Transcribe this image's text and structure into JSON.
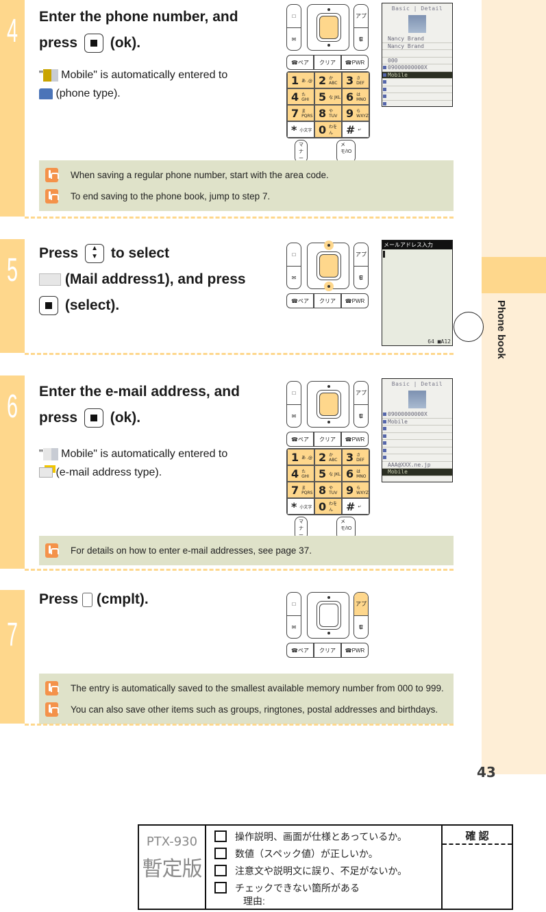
{
  "sidebar": {
    "section_label": "Phone book",
    "page_number": "43"
  },
  "steps": [
    {
      "number": "4",
      "heading_line1": "Enter the phone number, and",
      "heading_line2_pre": "press",
      "heading_line2_post": "(ok).",
      "desc_line1_pre": "\"",
      "desc_line1_post": " Mobile\" is automatically entered to",
      "desc_line2": " (phone type).",
      "notes": [
        "When saving a regular phone number, start with the area code.",
        "To end saving to the phone book, jump to step 7."
      ],
      "screen": {
        "tabs": "Basic | Detail",
        "rows": [
          "Nancy Brand",
          "Nancy Brand",
          "",
          "000",
          "09000000000X",
          "Mobile",
          "",
          "",
          "",
          ""
        ]
      }
    },
    {
      "number": "5",
      "heading_line1_pre": "Press",
      "heading_line1_post": "to select",
      "heading_line2": " (Mail address1), and press",
      "heading_line3": "(select).",
      "screen": {
        "title": "メールアドレス入力",
        "status": "64 ■A12"
      }
    },
    {
      "number": "6",
      "heading_line1": "Enter the e-mail address, and",
      "heading_line2_pre": "press",
      "heading_line2_post": "(ok).",
      "desc_line1_pre": "\"",
      "desc_line1_post": " Mobile\" is automatically entered to",
      "desc_line2": " (e-mail address type).",
      "notes": [
        "For details on how to enter e-mail addresses, see page 37."
      ],
      "screen": {
        "tabs": "Basic | Detail",
        "rows": [
          "09000000000X",
          "Mobile",
          "",
          "",
          "",
          "",
          "",
          "AAA@XXX.ne.jp",
          "Mobile"
        ]
      }
    },
    {
      "number": "7",
      "heading_pre": "Press",
      "heading_post": "(cmplt).",
      "notes": [
        "The entry is automatically saved to the smallest available memory number from 000 to 999.",
        "You can also save other items such as groups, ringtones, postal addresses and birthdays."
      ]
    }
  ],
  "keypad": {
    "side_top": "□",
    "side_mail": "✉",
    "side_appli": "アプリ",
    "side_e": "E",
    "call": "ペア",
    "clear": "クリア",
    "pwr": "PWR",
    "keys": [
      {
        "k": "1",
        "s": "あ .@"
      },
      {
        "k": "2",
        "s": "か ABC"
      },
      {
        "k": "3",
        "s": "さ DEF"
      },
      {
        "k": "4",
        "s": "た GHI"
      },
      {
        "k": "5",
        "s": "な JKL"
      },
      {
        "k": "6",
        "s": "は MNO"
      },
      {
        "k": "7",
        "s": "ま PQRS"
      },
      {
        "k": "8",
        "s": "や TUV"
      },
      {
        "k": "9",
        "s": "ら WXYZ"
      },
      {
        "k": "*",
        "s": "小文字"
      },
      {
        "k": "0",
        "s": "わをん"
      },
      {
        "k": "#",
        "s": "↵"
      }
    ],
    "soft_left": "マナー",
    "soft_right": "メモ/IO"
  },
  "check_table": {
    "model": "PTX-930",
    "status": "暫定版",
    "items": [
      "操作説明、画面が仕様とあっているか。",
      "数値（スペック値）が正しいか。",
      "注意文や説明文に誤り、不足がないか。",
      "チェックできない箇所がある"
    ],
    "reason_label": "理由:",
    "confirm_label": "確 認"
  }
}
